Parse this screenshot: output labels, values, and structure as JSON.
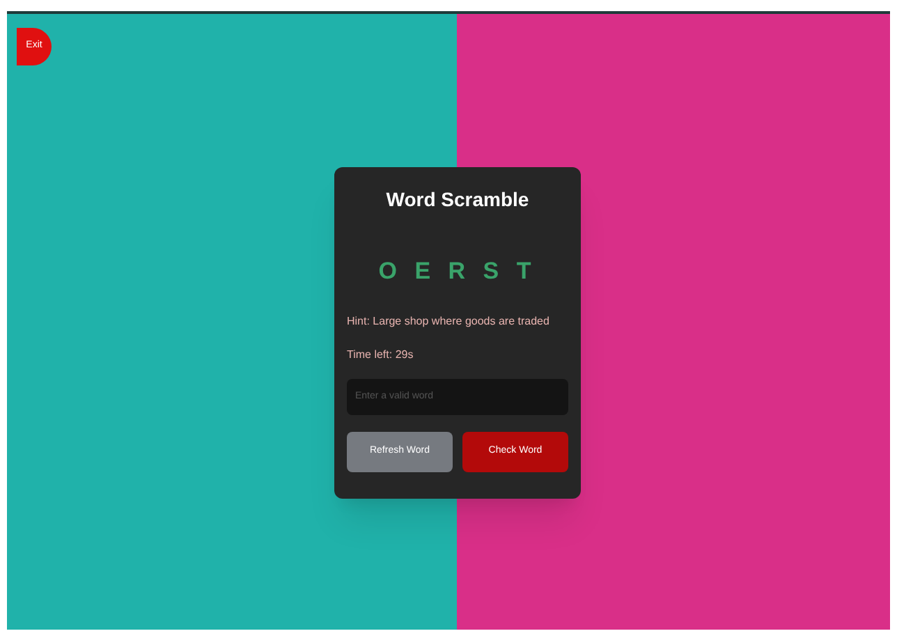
{
  "exit_button": {
    "label": "Exit"
  },
  "card": {
    "title": "Word Scramble",
    "scrambled_word": "O E R S T",
    "hint": "Hint: Large shop where goods are traded",
    "timer": "Time left: 29s",
    "input": {
      "placeholder": "Enter a valid word"
    },
    "buttons": [
      {
        "label": "Refresh Word",
        "kind": "secondary"
      },
      {
        "label": "Check Word",
        "kind": "primary"
      }
    ]
  }
}
